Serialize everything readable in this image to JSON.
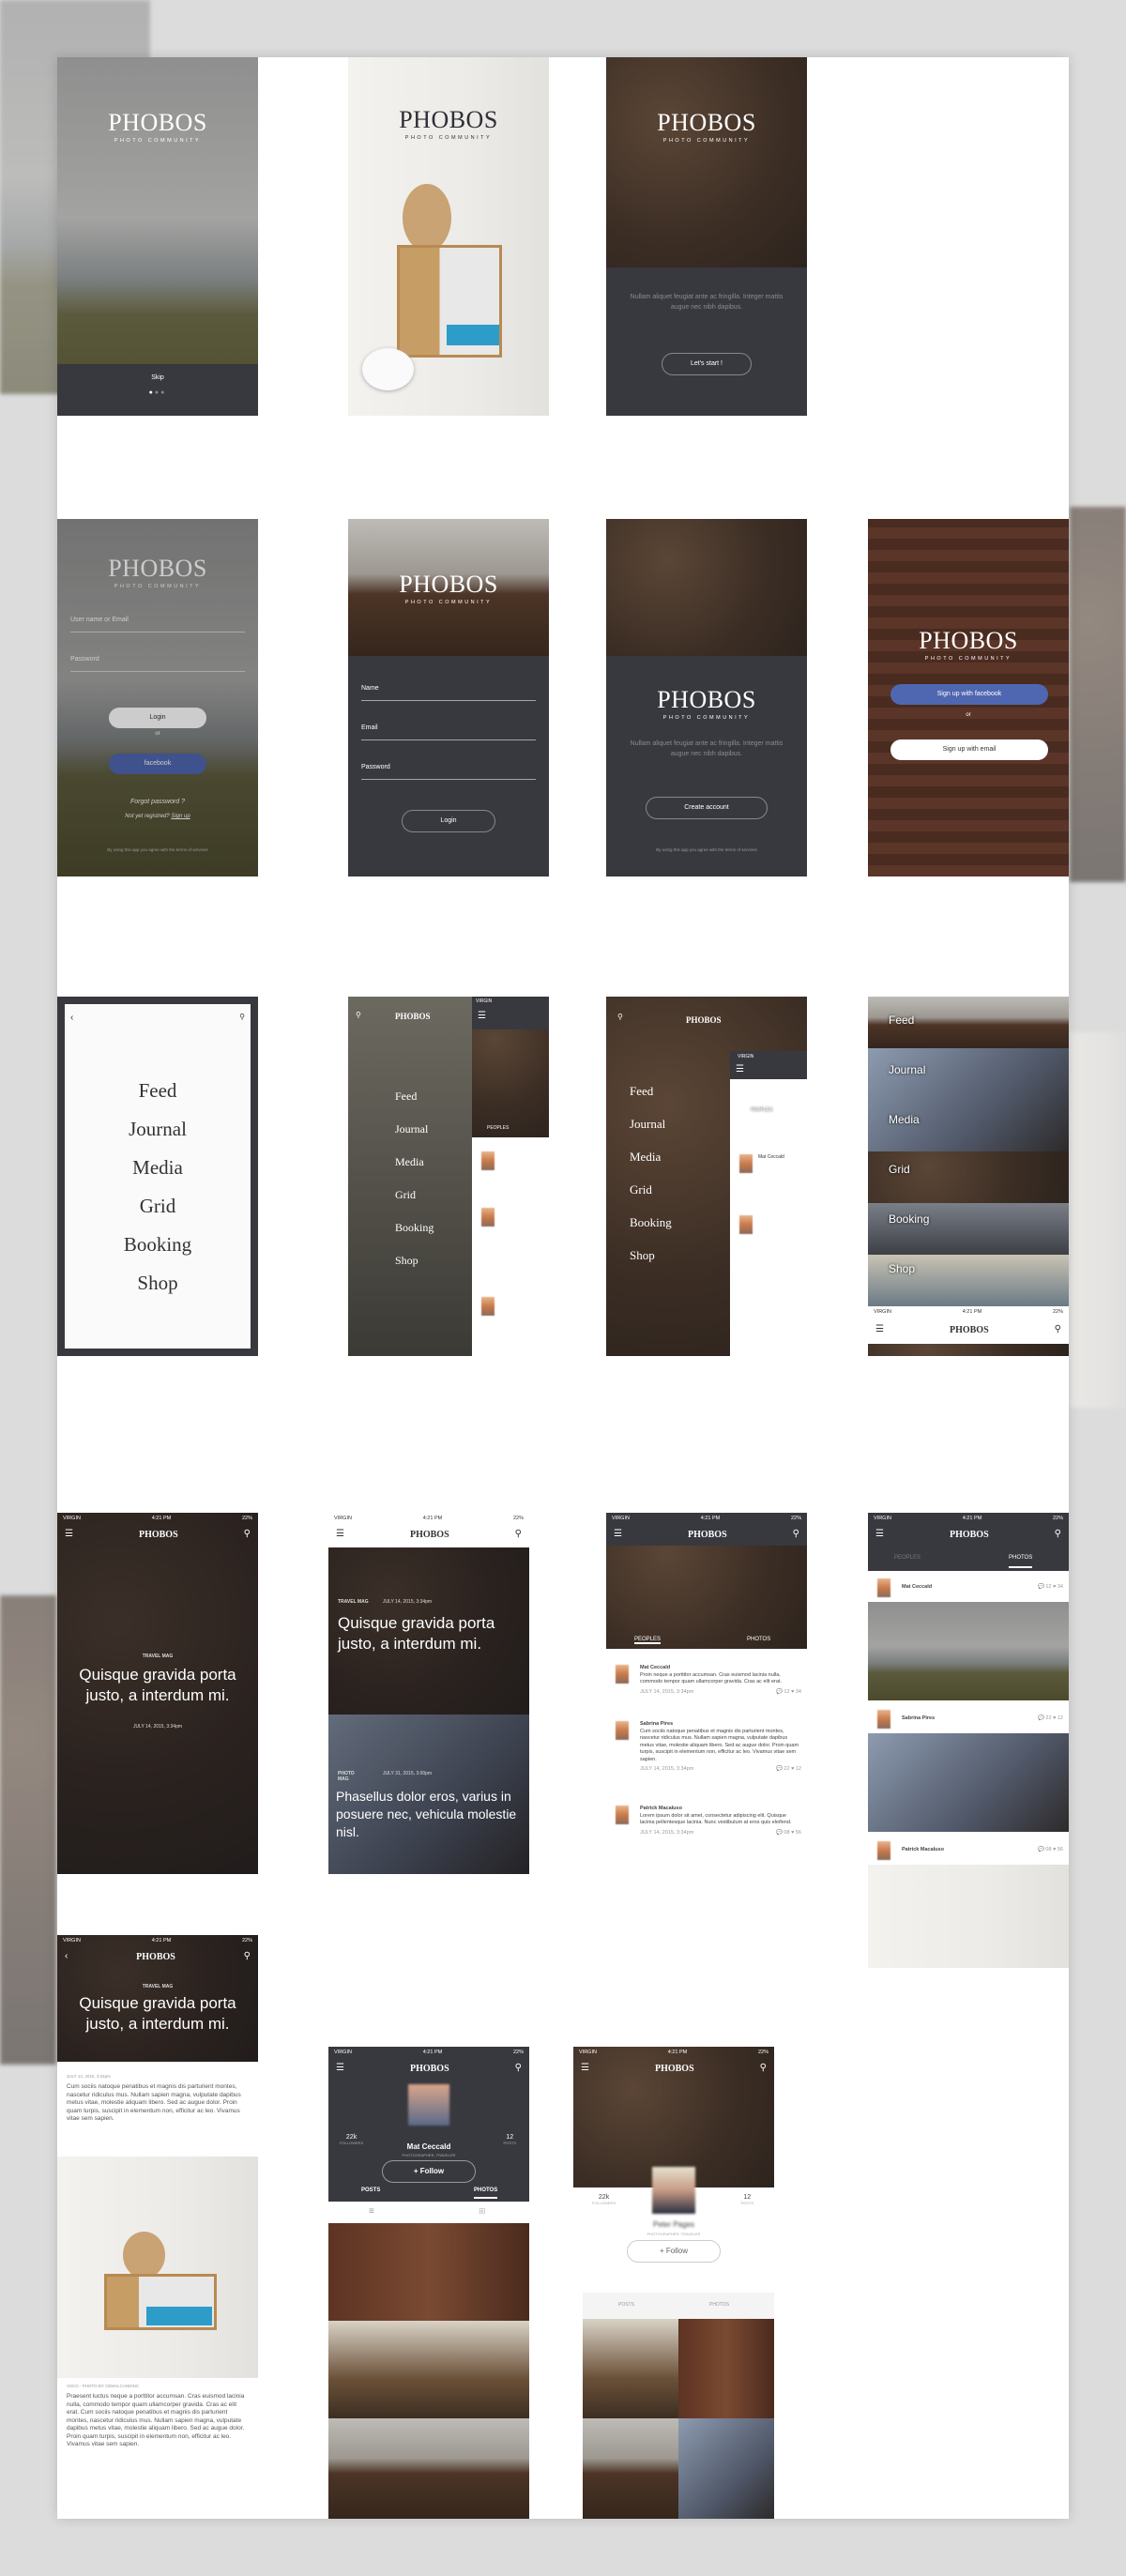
{
  "brand": {
    "name": "PHOBOS",
    "tagline": "PHOTO COMMUNITY"
  },
  "colors": {
    "dark": "#38383f",
    "facebook": "#4f67b0",
    "white": "#ffffff"
  },
  "status": {
    "carrier": "VIRGIN",
    "time": "4:21 PM",
    "battery": "22%"
  },
  "onboarding": {
    "skip": "Skip",
    "intro": "Nullam aliquet feugiat ante ac fringilla. Integer mattis augue nec nibh dapibus.",
    "start": "Let's start !",
    "page_index": 1,
    "page_count": 3
  },
  "login": {
    "user_label": "User name or Email",
    "password_label": "Password",
    "login": "Login",
    "or": "or",
    "facebook": "facebook",
    "forgot": "Forgot password ?",
    "not_registered": "Not yet registred?",
    "signup": "Sign up",
    "terms": "By using this app you agree with the terms of services"
  },
  "register": {
    "name": "Name",
    "email": "Email",
    "password": "Password",
    "login": "Login"
  },
  "create": {
    "intro": "Nullam aliquet feugiat ante ac fringilla. Integer mattis augue nec nibh dapibus.",
    "button": "Create account",
    "terms": "By using this app you agree with the terms of services"
  },
  "signup": {
    "facebook": "Sign up with facebook",
    "or": "or",
    "email": "Sign up with email"
  },
  "menu": {
    "items": [
      "Feed",
      "Journal",
      "Media",
      "Grid",
      "Booking",
      "Shop"
    ]
  },
  "tabs": {
    "peoples": "PEOPLES",
    "photos": "PHOTOS",
    "posts": "POSTS"
  },
  "feed": {
    "post1": {
      "category": "TRAVEL MAG",
      "title": "Quisque gravida porta justo, a interdum mi.",
      "date": "JULY 14, 2015, 3:34pm"
    },
    "post2": {
      "category": "PHOTO MAG",
      "title": "Phasellus dolor eros, varius in posuere nec, vehicula molestie nisl.",
      "date": "JULY 31, 2015, 3:00pm"
    }
  },
  "peoples": [
    {
      "name": "Mat Ceccald",
      "text": "Proin neque a porttitor accumsan. Cras euismod lacinia nulla, commodo tempor quam ullamcorper gravida. Cras ac elit erat.",
      "date": "JULY 14, 2015, 3:34pm",
      "comments": "12",
      "likes": "34"
    },
    {
      "name": "Sabrina Pires",
      "text": "Cum sociis natoque penatibus et magnis dis parturient montes, nascetur ridiculus mus. Nullam sapien magna, vulputate dapibus metus vitae, molestie aliquam libero. Sed ac augue dolor. Proin quam turpis, suscipit in elementum non, efficitur ac leo. Vivamus vitae sem sapien.",
      "date": "JULY 14, 2015, 3:34pm",
      "comments": "22",
      "likes": "12"
    },
    {
      "name": "Patrick Macaluso",
      "text": "Lorem ipsum dolor sit amet, consectetur adipiscing elit. Quisque lacinia pellentesque lacinia. Nunc vestibulum at eros quis eleifend.",
      "date": "JULY 14, 2015, 3:34pm",
      "comments": "08",
      "likes": "56"
    }
  ],
  "article": {
    "date": "JULY 14, 2015, 3:34pm",
    "p1": "Cum sociis natoque penatibus et magnis dis parturient montes, nascetur ridiculus mus. Nullam sapien magna, vulputate dapibus metus vitae, molestie aliquam libero. Sed ac augue dolor. Proin quam turpis, suscipit in elementum non, efficitur ac leo. Vivamus vitae sem sapien.",
    "caption": "VSCO - PHOTO BY CEMALCANDINC",
    "p2": "Praesent luctus neque a porttitor accumsan. Cras euismod lacinia nulla, commodo tempor quam ullamcorper gravida. Cras ac elit erat. Cum sociis natoque penatibus et magnis dis parturient montes, nascetur ridiculus mus. Nullam sapien magna, vulputate dapibus metus vitae, molestie aliquam libero. Sed ac augue dolor. Proin quam turpis, suscipit in elementum non, efficitur ac leo. Vivamus vitae sem sapien."
  },
  "profile1": {
    "name": "Mat Ceccald",
    "role": "PHOTOGRAPHER, TRAVELER",
    "followers": "22k",
    "followers_label": "FOLLOWERS",
    "posts": "12",
    "posts_label": "POSTS",
    "follow": "+ Follow"
  },
  "profile2": {
    "name": "Peter Pages",
    "role": "PHOTOGRAPHER, TRAVELER",
    "followers": "22k",
    "followers_label": "FOLLOWERS",
    "posts": "12",
    "posts_label": "POSTS",
    "follow": "+ Follow"
  }
}
